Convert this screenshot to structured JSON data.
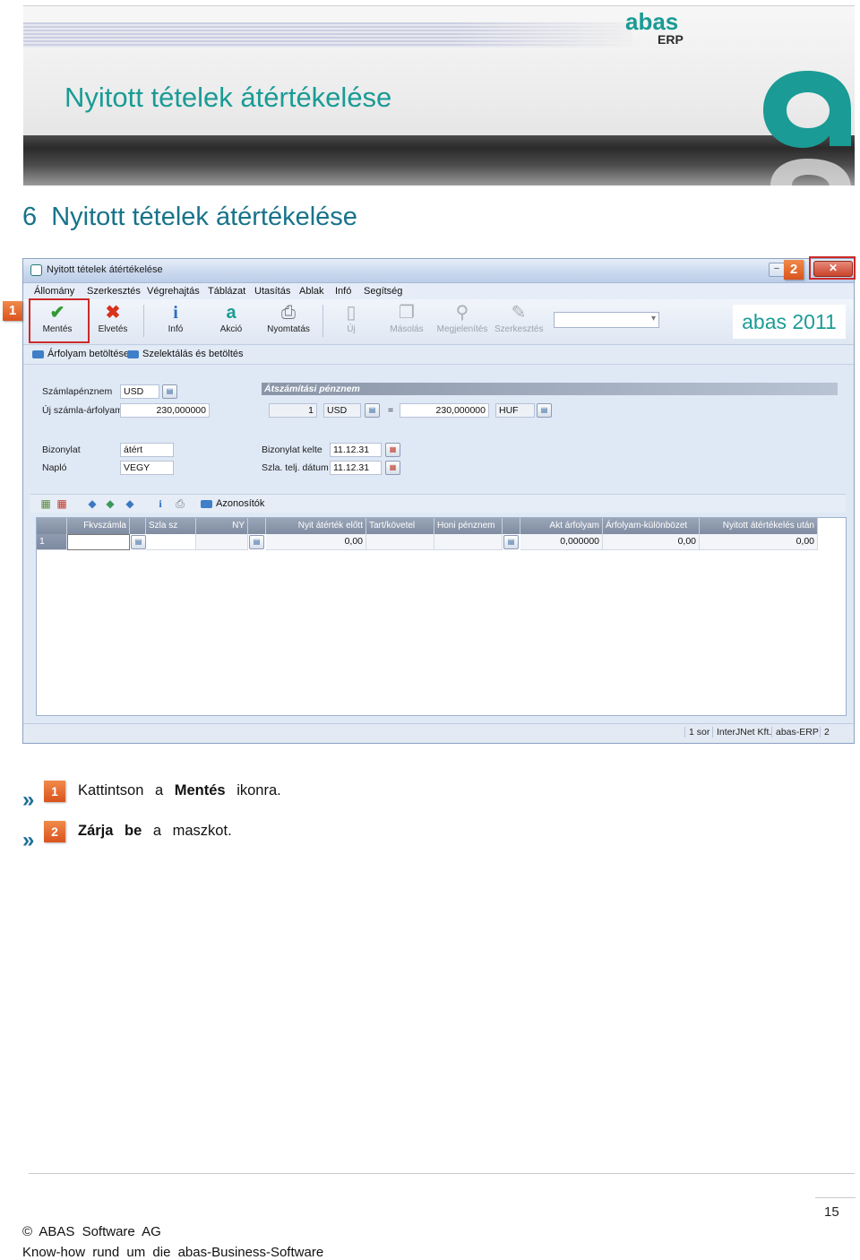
{
  "banner": {
    "title": "Nyitott tételek átértékelése",
    "logo_text_top": "abas",
    "logo_text_bottom": "ERP"
  },
  "section": {
    "number": "6",
    "title": "Nyitott tételek átértékelése"
  },
  "window": {
    "title": "Nyitott tételek átértékelése",
    "close_symbol": "✕",
    "menu": [
      "Állomány",
      "Szerkesztés",
      "Végrehajtás",
      "Táblázat",
      "Utasítás",
      "Ablak",
      "Infó",
      "Segítség"
    ],
    "toolbar": [
      {
        "label": "Mentés",
        "icon": "checkmark-icon",
        "enabled": true
      },
      {
        "label": "Elvetés",
        "icon": "cross-icon",
        "enabled": true
      },
      {
        "label": "Infó",
        "icon": "info-icon",
        "enabled": true
      },
      {
        "label": "Akció",
        "icon": "abas-a-icon",
        "enabled": true
      },
      {
        "label": "Nyomtatás",
        "icon": "printer-icon",
        "enabled": true
      },
      {
        "label": "Új",
        "icon": "new-document-icon",
        "enabled": false
      },
      {
        "label": "Másolás",
        "icon": "copy-icon",
        "enabled": false
      },
      {
        "label": "Megjelenítés",
        "icon": "magnifier-icon",
        "enabled": false
      },
      {
        "label": "Szerkesztés",
        "icon": "pencil-icon",
        "enabled": false
      }
    ],
    "brand_label": "abas 2011",
    "sub_links": [
      "Árfolyam betöltése",
      "Szelektálás és betöltés"
    ],
    "form": {
      "szamlapenznem_label": "Számlapénznem",
      "szamlapenznem_value": "USD",
      "uj_arfolyam_label": "Új számla-árfolyam",
      "uj_arfolyam_value": "230,000000",
      "atszamitasi_label": "Átszámítási pénznem",
      "conv_qty": "1",
      "conv_from": "USD",
      "conv_eq": "=",
      "conv_rate": "230,000000",
      "conv_to": "HUF",
      "bizonylat_label": "Bizonylat",
      "bizonylat_value": "átért",
      "naplo_label": "Napló",
      "naplo_value": "VEGY",
      "bizonylat_kelte_label": "Bizonylat kelte",
      "bizonylat_kelte_value": "11.12.31",
      "szla_telj_label": "Szla. telj. dátum",
      "szla_telj_value": "11.12.31"
    },
    "grid_toolbar_link": "Azonosítók",
    "grid": {
      "headers": [
        "Fkvszámla",
        "Szla sz",
        "NY",
        "Nyit átérték előtt",
        "Tart/követel",
        "Honi pénznem",
        "Akt árfolyam",
        "Árfolyam-különbözet",
        "Nyitott átértékelés után"
      ],
      "row": {
        "num": "1",
        "nyit_atertek_elott": "0,00",
        "akt_arfolyam": "0,000000",
        "arfolyam_kulonbozet": "0,00",
        "nyitott_atertekeles_utan": "0,00"
      }
    },
    "status": [
      "1 sor",
      "InterJNet Kft.",
      "abas-ERP",
      "2"
    ]
  },
  "callouts": {
    "one": "1",
    "two": "2"
  },
  "instructions": [
    {
      "marker": "»",
      "num": "1",
      "pre": "Kattintson a",
      "bold": "Mentés",
      "post": "ikonra."
    },
    {
      "marker": "»",
      "num": "2",
      "bold": "Zárja be",
      "post": "a maszkot."
    }
  ],
  "footer": {
    "page_number": "15",
    "copyright": "© ABAS Software AG",
    "tagline": "Know-how rund um die abas-Business-Software"
  },
  "colors": {
    "accent_teal": "#1a9b95",
    "section_blue": "#18738a",
    "callout_orange": "#e5672b",
    "highlight_red": "#cc2a2a"
  }
}
